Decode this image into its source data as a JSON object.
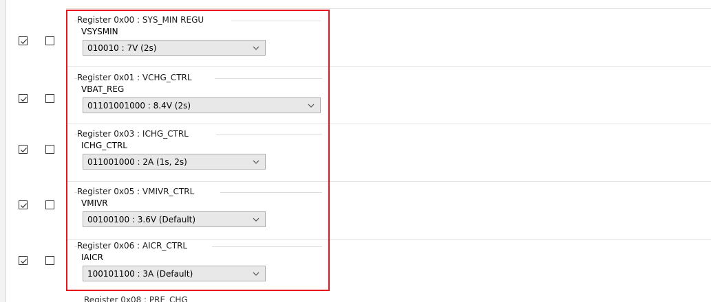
{
  "registers": [
    {
      "title": "Register 0x00 : SYS_MIN REGU",
      "field": "VSYSMIN",
      "value": "010010 : 7V (2s)",
      "enabled": true,
      "other_checked": false
    },
    {
      "title": "Register 0x01 : VCHG_CTRL",
      "field": "VBAT_REG",
      "value": "01101001000 : 8.4V (2s)",
      "enabled": true,
      "other_checked": false
    },
    {
      "title": "Register 0x03 : ICHG_CTRL",
      "field": "ICHG_CTRL",
      "value": "011001000 : 2A (1s, 2s)",
      "enabled": true,
      "other_checked": false
    },
    {
      "title": "Register 0x05 : VMIVR_CTRL",
      "field": "VMIVR",
      "value": "00100100 : 3.6V (Default)",
      "enabled": true,
      "other_checked": false
    },
    {
      "title": "Register 0x06 : AICR_CTRL",
      "field": "IAICR",
      "value": "100101100 : 3A (Default)",
      "enabled": true,
      "other_checked": false
    }
  ],
  "next_register_partial": "Register 0x08 : PRE_CHG",
  "colors": {
    "highlight": "#e8141d"
  }
}
